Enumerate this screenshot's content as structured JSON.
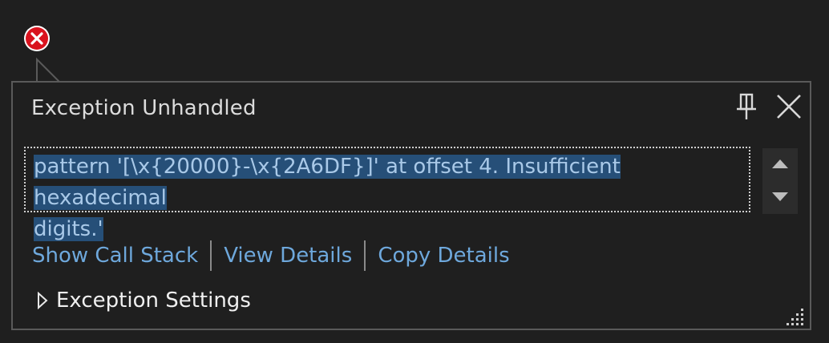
{
  "dialog": {
    "title": "Exception Unhandled",
    "message": "pattern '[\\x{20000}-\\x{2A6DF}]' at offset 4. Insufficient hexadecimal digits.'",
    "message_line1": "pattern '[\\x{20000}-\\x{2A6DF}]' at offset 4. Insufficient hexadecimal",
    "message_line2": "digits.'",
    "pin_icon": "pin-icon",
    "close_icon": "close-icon"
  },
  "links": {
    "call_stack": "Show Call Stack",
    "view_details": "View Details",
    "copy_details": "Copy Details"
  },
  "settings": {
    "label": "Exception Settings",
    "icon": "caret-right-icon"
  },
  "colors": {
    "background": "#1f1f1f",
    "border": "#5a5a5a",
    "link": "#6ea8dc",
    "selection": "#264f78",
    "error": "#e51400"
  }
}
